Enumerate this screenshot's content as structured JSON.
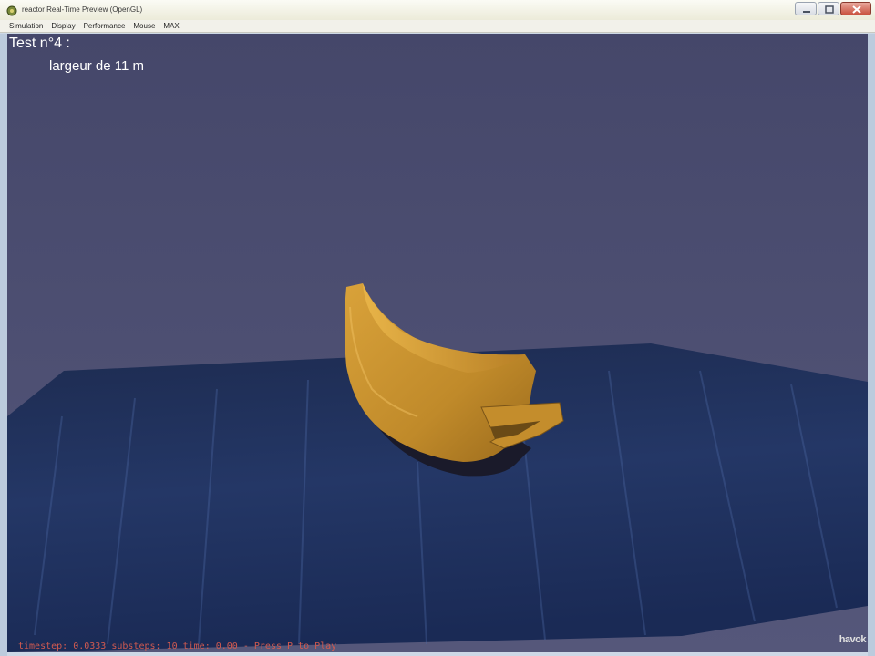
{
  "window": {
    "title": "reactor Real-Time Preview (OpenGL)",
    "app_icon": "havok-reactor-icon"
  },
  "menu": {
    "items": [
      {
        "label": "Simulation"
      },
      {
        "label": "Display"
      },
      {
        "label": "Performance"
      },
      {
        "label": "Mouse"
      },
      {
        "label": "MAX"
      }
    ]
  },
  "overlay": {
    "title": "Test n°4 :",
    "subtitle": "largeur de 11 m"
  },
  "status": {
    "line": "timestep: 0.0333 substeps: 10 time: 0.00 - Press P to Play"
  },
  "logo": {
    "text": "havok"
  },
  "colors": {
    "background": "#4a4c6d",
    "floor": "#1c2c52",
    "boat": "#c8952e",
    "status_text": "#d05a50"
  }
}
